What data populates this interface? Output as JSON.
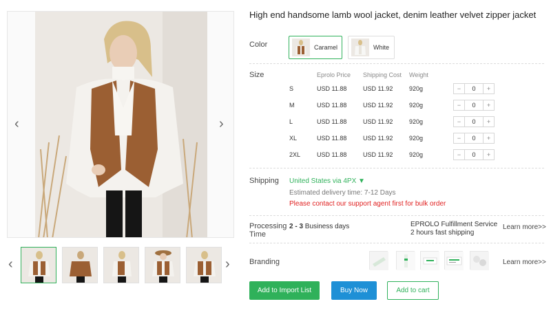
{
  "product": {
    "title": "High end handsome lamb wool jacket, denim leather velvet zipper jacket"
  },
  "gallery": {
    "prev_arrow": "‹",
    "next_arrow": "›",
    "thumb_prev": "‹",
    "thumb_next": "›",
    "thumbnails": [
      "front",
      "back",
      "side",
      "hat",
      "front-2"
    ]
  },
  "color": {
    "label": "Color",
    "options": [
      {
        "name": "Caramel",
        "selected": true
      },
      {
        "name": "White",
        "selected": false
      }
    ]
  },
  "size": {
    "label": "Size",
    "headers": {
      "price": "Eprolo Price",
      "shipping": "Shipping Cost",
      "weight": "Weight"
    },
    "rows": [
      {
        "size": "S",
        "price": "USD 11.88",
        "shipping": "USD 11.92",
        "weight": "920g",
        "qty": "0"
      },
      {
        "size": "M",
        "price": "USD 11.88",
        "shipping": "USD 11.92",
        "weight": "920g",
        "qty": "0"
      },
      {
        "size": "L",
        "price": "USD 11.88",
        "shipping": "USD 11.92",
        "weight": "920g",
        "qty": "0"
      },
      {
        "size": "XL",
        "price": "USD 11.88",
        "shipping": "USD 11.92",
        "weight": "920g",
        "qty": "0"
      },
      {
        "size": "2XL",
        "price": "USD 11.88",
        "shipping": "USD 11.92",
        "weight": "920g",
        "qty": "0"
      }
    ],
    "minus": "−",
    "plus": "+"
  },
  "shipping": {
    "label": "Shipping",
    "method": "United States via 4PX ▼",
    "estimate": "Estimated delivery time: 7-12 Days",
    "warning": "Please contact our support agent first for bulk order"
  },
  "processing": {
    "label": "Processing Time",
    "days_bold": "2 - 3",
    "days_rest": " Business days",
    "service_line1": "EPROLO Fulfillment Service",
    "service_line2": "2 hours fast shipping",
    "learn_more": "Learn more>>"
  },
  "branding": {
    "label": "Branding",
    "learn_more": "Learn more>>"
  },
  "actions": {
    "import": "Add to Import List",
    "buy": "Buy Now",
    "cart": "Add to cart"
  },
  "colors": {
    "accent_green": "#2fb15a",
    "buy_blue": "#1e90d6",
    "warning_red": "#e02020"
  }
}
